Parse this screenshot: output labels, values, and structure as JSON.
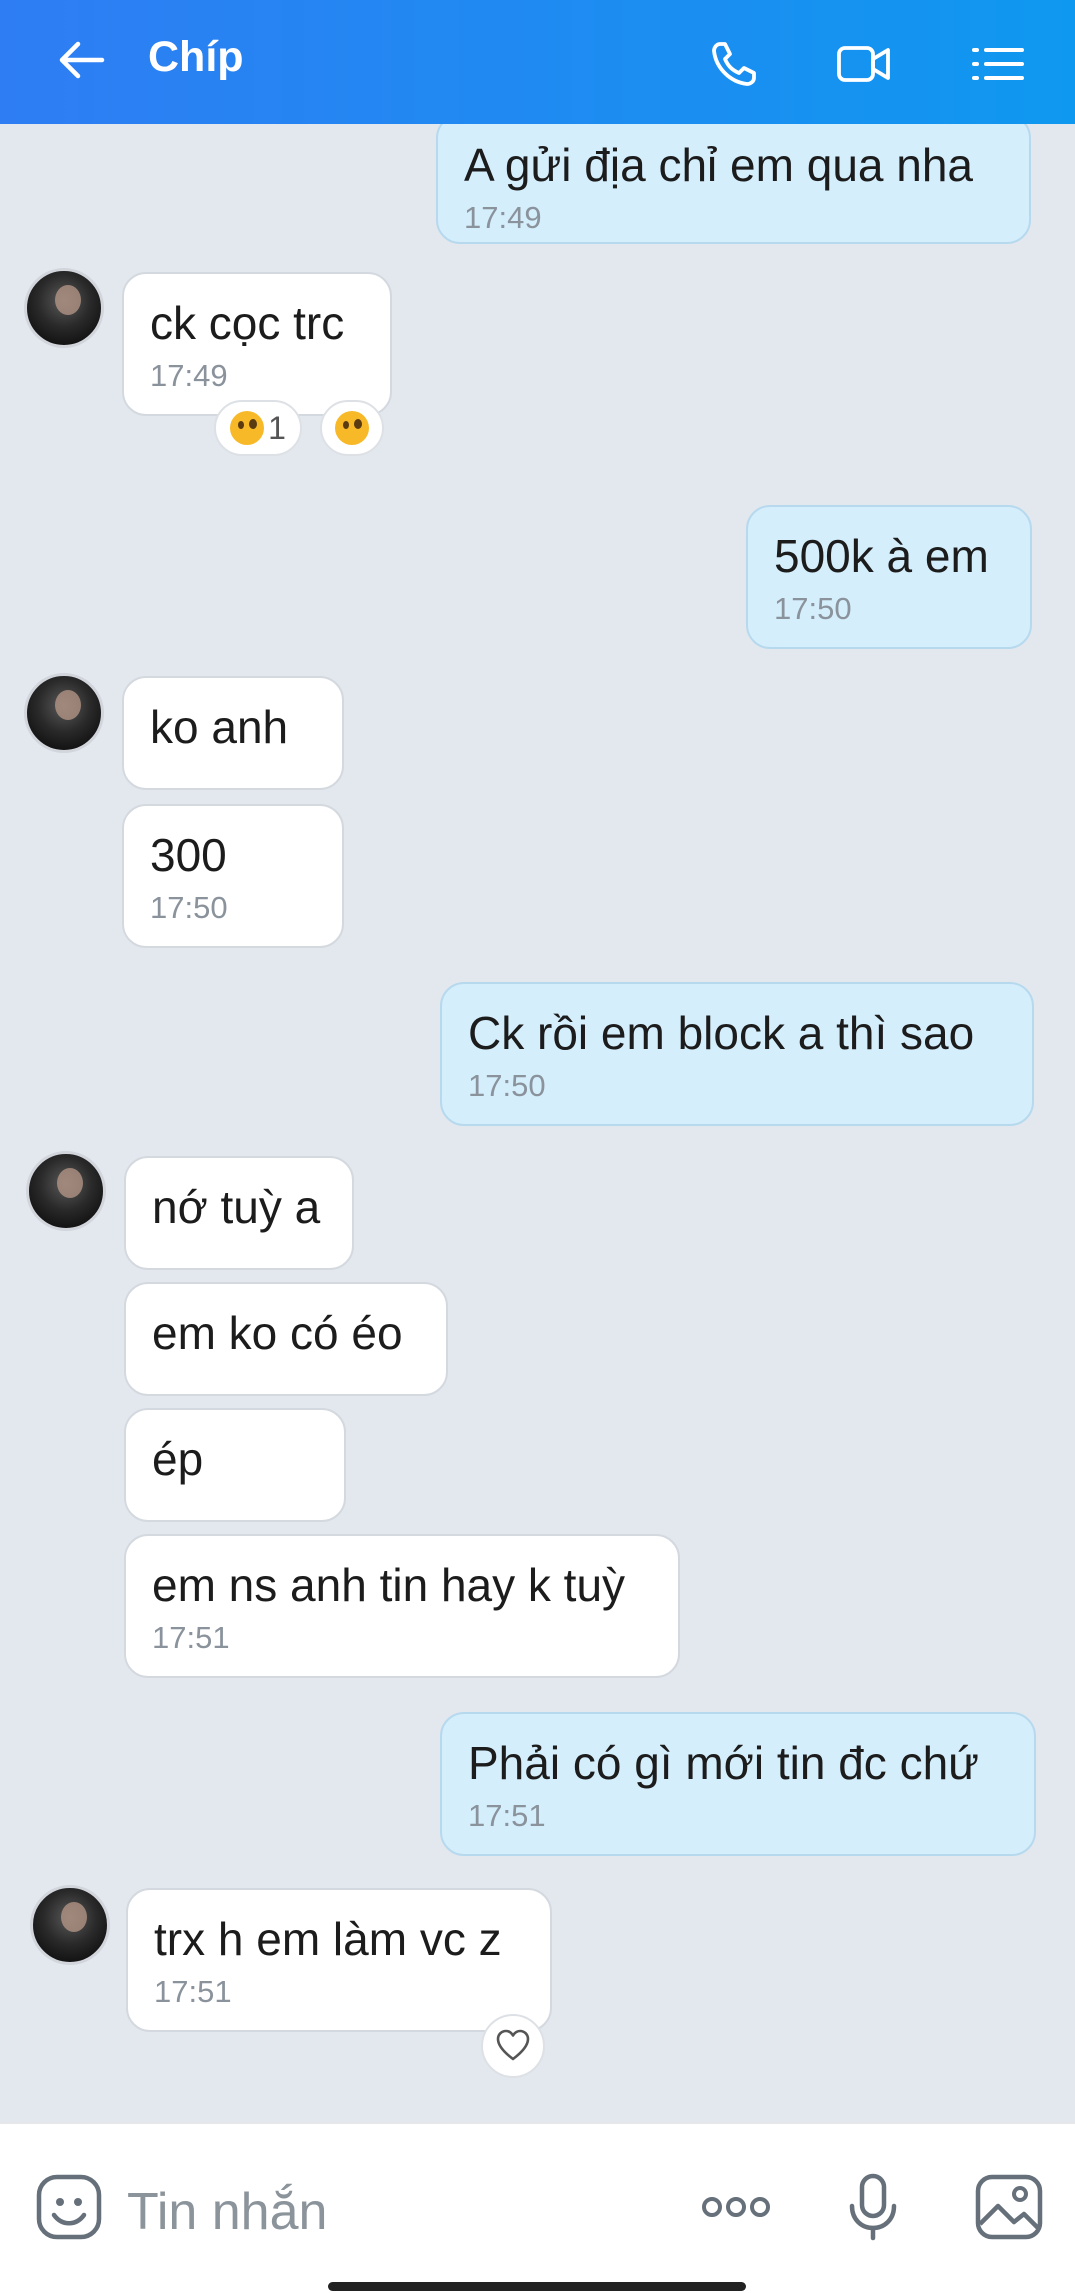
{
  "header": {
    "title": "Chíp",
    "icons": [
      "back-arrow-icon",
      "phone-icon",
      "video-icon",
      "menu-list-icon"
    ],
    "color": "#1d8ff1"
  },
  "messages": [
    {
      "side": "out",
      "text": "A gửi địa chỉ em qua nha",
      "time": "17:49"
    },
    {
      "side": "in",
      "text": "ck cọc trc",
      "time": "17:49",
      "reactions": [
        {
          "emoji": "flushed-face",
          "count": "1"
        },
        {
          "emoji": "flushed-face"
        }
      ]
    },
    {
      "side": "out",
      "text": "500k à em",
      "time": "17:50"
    },
    {
      "side": "in",
      "text": "ko anh"
    },
    {
      "side": "in",
      "text": "300",
      "time": "17:50"
    },
    {
      "side": "out",
      "text": "Ck rồi em block a thì sao",
      "time": "17:50"
    },
    {
      "side": "in",
      "text": "nớ tuỳ a"
    },
    {
      "side": "in",
      "text": "em ko có éo"
    },
    {
      "side": "in",
      "text": "ép"
    },
    {
      "side": "in",
      "text": "em ns anh tin hay k tuỳ",
      "time": "17:51"
    },
    {
      "side": "out",
      "text": "Phải có gì mới tin đc chứ",
      "time": "17:51"
    },
    {
      "side": "in",
      "text": "trx h em làm vc z",
      "time": "17:51",
      "reactions": [
        {
          "emoji": "heart-outline"
        }
      ]
    }
  ],
  "composer": {
    "placeholder": "Tin nhắn",
    "icons": [
      "sticker-icon",
      "more-icon",
      "microphone-icon",
      "image-icon"
    ]
  }
}
